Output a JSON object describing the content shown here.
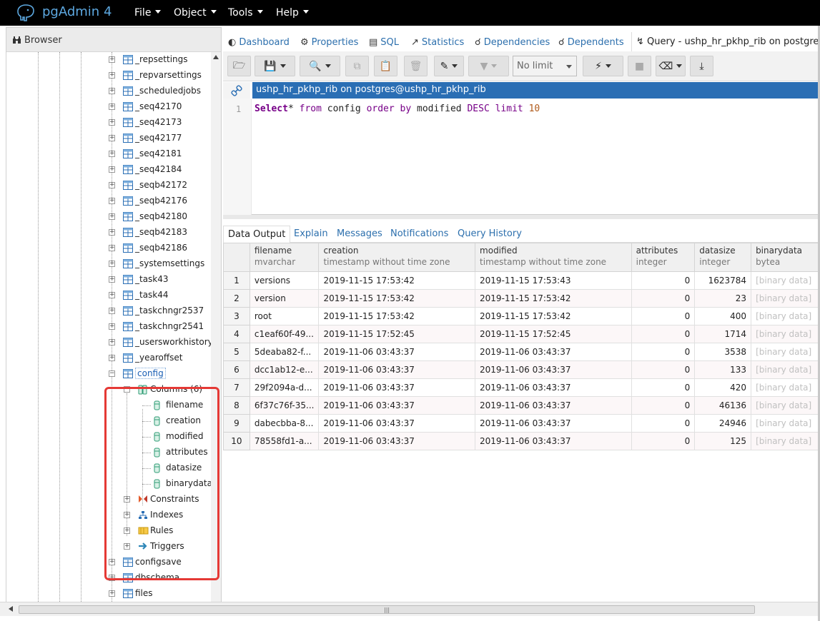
{
  "app": {
    "brand": "pgAdmin 4"
  },
  "menu": [
    {
      "label": "File"
    },
    {
      "label": "Object"
    },
    {
      "label": "Tools"
    },
    {
      "label": "Help"
    }
  ],
  "browser": {
    "title": "Browser",
    "tree": [
      {
        "label": "_repsettings",
        "level": 2,
        "icon": "table-icon",
        "toggle": "+"
      },
      {
        "label": "_repvarsettings",
        "level": 2,
        "icon": "table-icon",
        "toggle": "+"
      },
      {
        "label": "_scheduledjobs",
        "level": 2,
        "icon": "table-icon",
        "toggle": "+"
      },
      {
        "label": "_seq42170",
        "level": 2,
        "icon": "table-icon",
        "toggle": "+"
      },
      {
        "label": "_seq42173",
        "level": 2,
        "icon": "table-icon",
        "toggle": "+"
      },
      {
        "label": "_seq42177",
        "level": 2,
        "icon": "table-icon",
        "toggle": "+"
      },
      {
        "label": "_seq42181",
        "level": 2,
        "icon": "table-icon",
        "toggle": "+"
      },
      {
        "label": "_seq42184",
        "level": 2,
        "icon": "table-icon",
        "toggle": "+"
      },
      {
        "label": "_seqb42172",
        "level": 2,
        "icon": "table-icon",
        "toggle": "+"
      },
      {
        "label": "_seqb42176",
        "level": 2,
        "icon": "table-icon",
        "toggle": "+"
      },
      {
        "label": "_seqb42180",
        "level": 2,
        "icon": "table-icon",
        "toggle": "+"
      },
      {
        "label": "_seqb42183",
        "level": 2,
        "icon": "table-icon",
        "toggle": "+"
      },
      {
        "label": "_seqb42186",
        "level": 2,
        "icon": "table-icon",
        "toggle": "+"
      },
      {
        "label": "_systemsettings",
        "level": 2,
        "icon": "table-icon",
        "toggle": "+"
      },
      {
        "label": "_task43",
        "level": 2,
        "icon": "table-icon",
        "toggle": "+"
      },
      {
        "label": "_task44",
        "level": 2,
        "icon": "table-icon",
        "toggle": "+"
      },
      {
        "label": "_taskchngr2537",
        "level": 2,
        "icon": "table-icon",
        "toggle": "+"
      },
      {
        "label": "_taskchngr2541",
        "level": 2,
        "icon": "table-icon",
        "toggle": "+"
      },
      {
        "label": "_usersworkhistory",
        "level": 2,
        "icon": "table-icon",
        "toggle": "+"
      },
      {
        "label": "_yearoffset",
        "level": 2,
        "icon": "table-icon",
        "toggle": "+"
      },
      {
        "label": "config",
        "level": 2,
        "icon": "table-icon",
        "toggle": "-",
        "selected": true
      },
      {
        "label": "Columns (6)",
        "level": 3,
        "icon": "columns-icon",
        "toggle": "-"
      },
      {
        "label": "filename",
        "level": 4,
        "icon": "column-icon",
        "toggle": ""
      },
      {
        "label": "creation",
        "level": 4,
        "icon": "column-icon",
        "toggle": ""
      },
      {
        "label": "modified",
        "level": 4,
        "icon": "column-icon",
        "toggle": ""
      },
      {
        "label": "attributes",
        "level": 4,
        "icon": "column-icon",
        "toggle": ""
      },
      {
        "label": "datasize",
        "level": 4,
        "icon": "column-icon",
        "toggle": ""
      },
      {
        "label": "binarydata",
        "level": 4,
        "icon": "column-icon",
        "toggle": ""
      },
      {
        "label": "Constraints",
        "level": 3,
        "icon": "constraints-icon",
        "toggle": "+"
      },
      {
        "label": "Indexes",
        "level": 3,
        "icon": "indexes-icon",
        "toggle": "+"
      },
      {
        "label": "Rules",
        "level": 3,
        "icon": "rules-icon",
        "toggle": "+"
      },
      {
        "label": "Triggers",
        "level": 3,
        "icon": "triggers-icon",
        "toggle": "+"
      },
      {
        "label": "configsave",
        "level": 2,
        "icon": "table-icon",
        "toggle": "+"
      },
      {
        "label": "dbschema",
        "level": 2,
        "icon": "table-icon",
        "toggle": "+"
      },
      {
        "label": "files",
        "level": 2,
        "icon": "table-icon",
        "toggle": "+"
      }
    ]
  },
  "tabs": [
    {
      "label": "Dashboard",
      "icon": "dashboard-icon"
    },
    {
      "label": "Properties",
      "icon": "properties-icon"
    },
    {
      "label": "SQL",
      "icon": "sql-icon"
    },
    {
      "label": "Statistics",
      "icon": "statistics-icon"
    },
    {
      "label": "Dependencies",
      "icon": "dependencies-icon"
    },
    {
      "label": "Dependents",
      "icon": "dependents-icon"
    }
  ],
  "query_tab": {
    "label": "Query - ushp_hr_pkhp_rib on postgres@u"
  },
  "toolbar": {
    "limit_value": "No limit"
  },
  "connection": {
    "label": "ushp_hr_pkhp_rib on postgres@ushp_hr_pkhp_rib"
  },
  "editor": {
    "line_number": "1",
    "tokens": {
      "select": "Select",
      "star": "*",
      "from": "from",
      "table": "config",
      "order_by": "order by",
      "column": "modified",
      "desc": "DESC",
      "limit": "limit",
      "limit_value": "10"
    }
  },
  "result_tabs": [
    {
      "label": "Data Output",
      "active": true
    },
    {
      "label": "Explain"
    },
    {
      "label": "Messages"
    },
    {
      "label": "Notifications"
    },
    {
      "label": "Query History"
    }
  ],
  "grid": {
    "columns": [
      {
        "name": "filename",
        "type": "mvarchar"
      },
      {
        "name": "creation",
        "type": "timestamp without time zone"
      },
      {
        "name": "modified",
        "type": "timestamp without time zone"
      },
      {
        "name": "attributes",
        "type": "integer"
      },
      {
        "name": "datasize",
        "type": "integer"
      },
      {
        "name": "binarydata",
        "type": "bytea"
      }
    ],
    "rows": [
      [
        "1",
        "versions",
        "2019-11-15 17:53:42",
        "2019-11-15 17:53:43",
        "0",
        "1623784",
        "[binary data]"
      ],
      [
        "2",
        "version",
        "2019-11-15 17:53:42",
        "2019-11-15 17:53:42",
        "0",
        "23",
        "[binary data]"
      ],
      [
        "3",
        "root",
        "2019-11-15 17:53:42",
        "2019-11-15 17:53:42",
        "0",
        "400",
        "[binary data]"
      ],
      [
        "4",
        "c1eaf60f-49...",
        "2019-11-15 17:52:45",
        "2019-11-15 17:52:45",
        "0",
        "1714",
        "[binary data]"
      ],
      [
        "5",
        "5deaba82-f...",
        "2019-11-06 03:43:37",
        "2019-11-06 03:43:37",
        "0",
        "3538",
        "[binary data]"
      ],
      [
        "6",
        "dcc1ab12-e...",
        "2019-11-06 03:43:37",
        "2019-11-06 03:43:37",
        "0",
        "133",
        "[binary data]"
      ],
      [
        "7",
        "29f2094a-d...",
        "2019-11-06 03:43:37",
        "2019-11-06 03:43:37",
        "0",
        "420",
        "[binary data]"
      ],
      [
        "8",
        "6f37c76f-35...",
        "2019-11-06 03:43:37",
        "2019-11-06 03:43:37",
        "0",
        "46136",
        "[binary data]"
      ],
      [
        "9",
        "dabecbba-8...",
        "2019-11-06 03:43:37",
        "2019-11-06 03:43:37",
        "0",
        "24946",
        "[binary data]"
      ],
      [
        "10",
        "78558fd1-a...",
        "2019-11-06 03:43:37",
        "2019-11-06 03:43:37",
        "0",
        "125",
        "[binary data]"
      ]
    ]
  },
  "colors": {
    "navbar": "#000000",
    "accent": "#2a6eb4",
    "link": "#2c6fad",
    "highlight_box": "#e53935",
    "sql_keyword": "#770088",
    "sql_number": "#b05a1a"
  }
}
